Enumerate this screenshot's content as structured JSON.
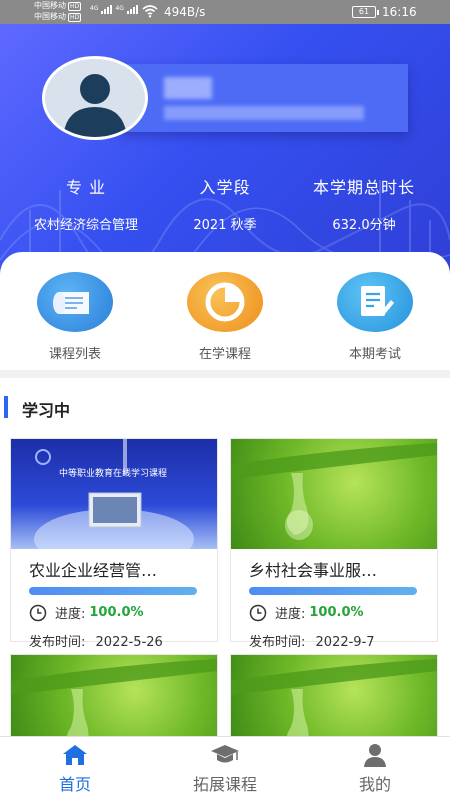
{
  "status_bar": {
    "carrier_1": "中国移动",
    "carrier_2": "中国移动",
    "hd": "HD",
    "net_1": "4G",
    "net_2": "4G",
    "speed": "494B/s",
    "battery": "61",
    "time": "16:16"
  },
  "profile": {
    "stats": [
      {
        "label": "专 业",
        "value": "农村经济综合管理"
      },
      {
        "label": "入学段",
        "value": "2021 秋季"
      },
      {
        "label": "本学期总时长",
        "value": "632.0分钟"
      }
    ]
  },
  "quick_links": [
    {
      "label": "课程列表",
      "icon": "course-list-icon",
      "color": "#3a8ee8"
    },
    {
      "label": "在学课程",
      "icon": "pie-chart-icon",
      "color": "#f2a02e"
    },
    {
      "label": "本期考试",
      "icon": "exam-icon",
      "color": "#34a6ea"
    }
  ],
  "learning": {
    "title": "学习中",
    "progress_label": "进度:",
    "date_label": "发布时间:",
    "courses": [
      {
        "title": "农业企业经营管…",
        "progress": "100.0%",
        "progress_fraction": 1.0,
        "date": "2022-5-26",
        "thumb_caption": "中等职业教育在线学习课程"
      },
      {
        "title": "乡村社会事业服…",
        "progress": "100.0%",
        "progress_fraction": 1.0,
        "date": "2022-9-7"
      }
    ]
  },
  "bottom_nav": {
    "tabs": [
      {
        "label": "首页",
        "icon": "home-icon",
        "active": true
      },
      {
        "label": "拓展课程",
        "icon": "graduation-cap-icon",
        "active": false
      },
      {
        "label": "我的",
        "icon": "user-icon",
        "active": false
      }
    ]
  },
  "colors": {
    "primary": "#1f6fe0",
    "progress_text": "#23a537",
    "header_blue": "#3550f0"
  }
}
